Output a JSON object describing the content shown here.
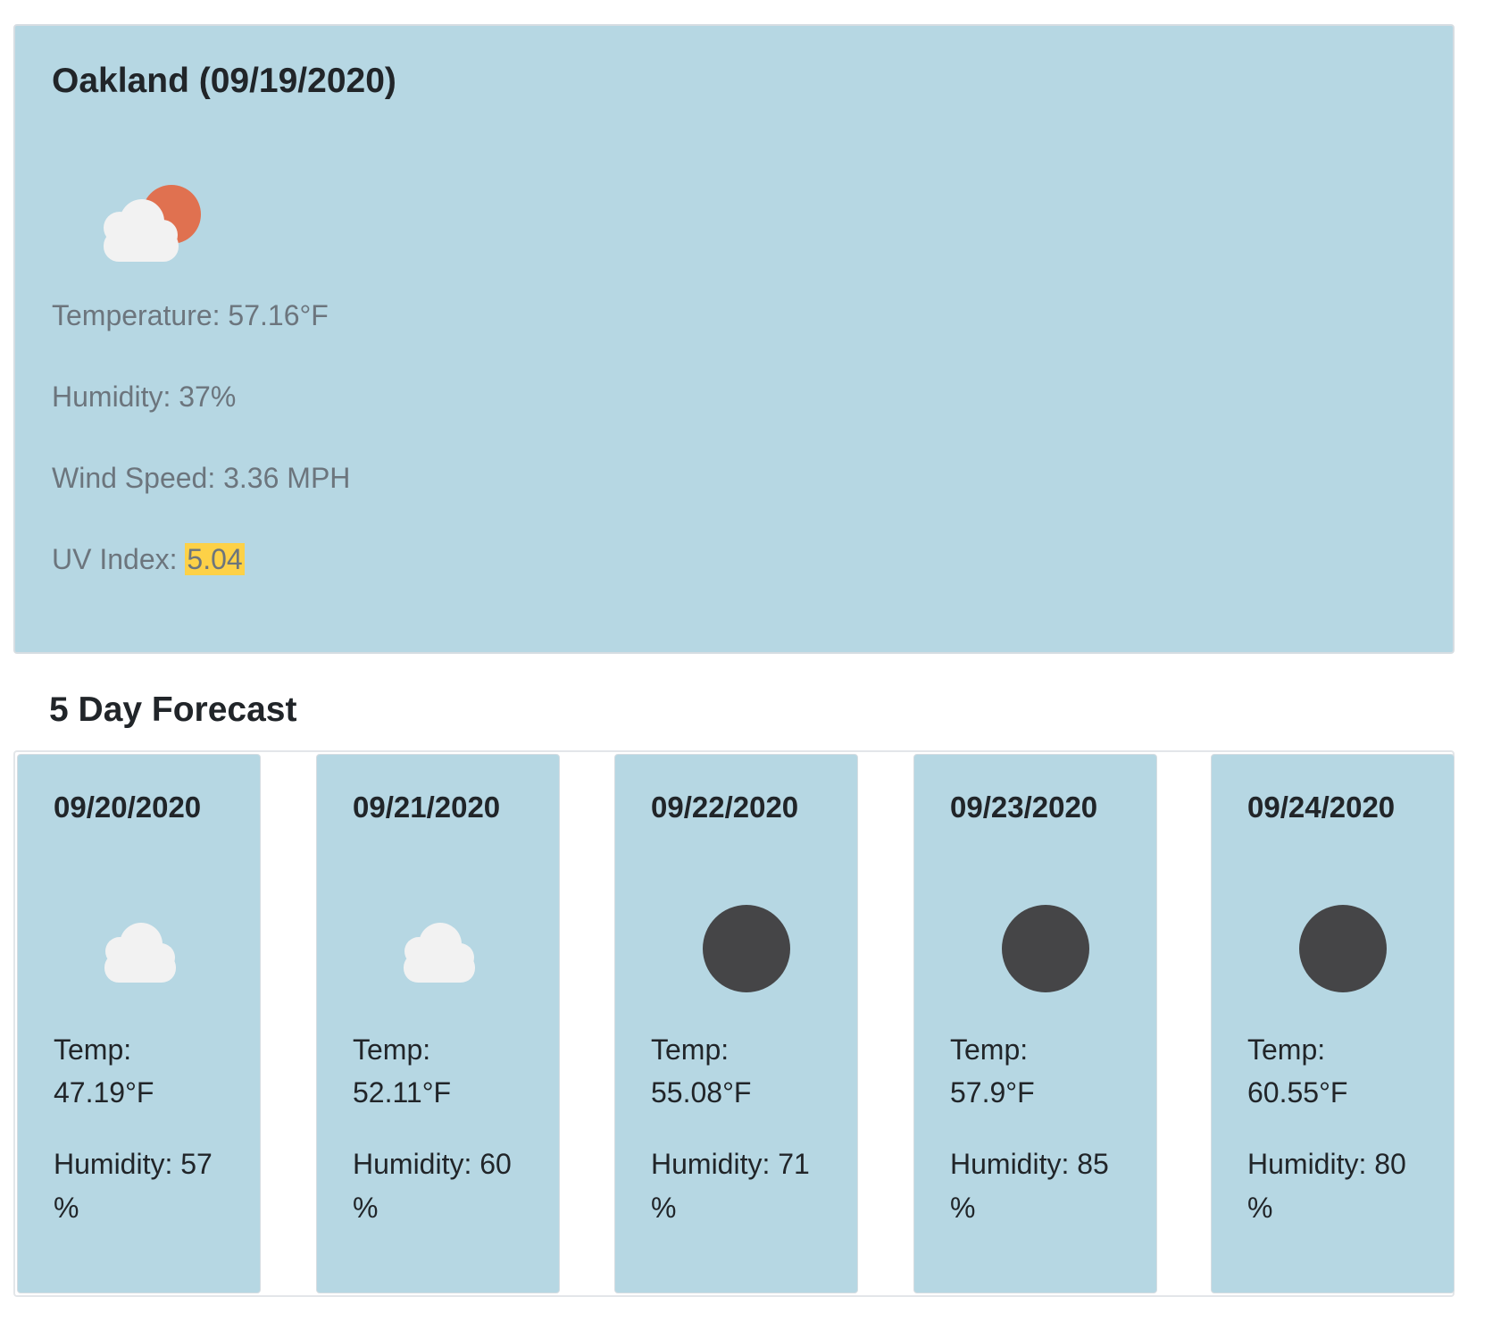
{
  "current": {
    "title": "Oakland (09/19/2020)",
    "icon": "partly-cloudy-day-icon",
    "temperature": "Temperature: 57.16°F",
    "humidity": "Humidity: 37%",
    "wind_speed": "Wind Speed: 3.36 MPH",
    "uv_label": "UV Index: ",
    "uv_value": "5.04",
    "uv_color": "#fdd147"
  },
  "forecast": {
    "heading": "5 Day Forecast",
    "days": [
      {
        "date": "09/20/2020",
        "icon": "cloud-icon",
        "temp_label": "Temp:",
        "temp_value": "47.19°F",
        "humidity_label": "Humidity: 57",
        "humidity_unit": "%"
      },
      {
        "date": "09/21/2020",
        "icon": "cloud-icon",
        "temp_label": "Temp:",
        "temp_value": "52.11°F",
        "humidity_label": "Humidity: 60",
        "humidity_unit": "%"
      },
      {
        "date": "09/22/2020",
        "icon": "moon-icon",
        "temp_label": "Temp:",
        "temp_value": "55.08°F",
        "humidity_label": "Humidity: 71",
        "humidity_unit": "%"
      },
      {
        "date": "09/23/2020",
        "icon": "moon-icon",
        "temp_label": "Temp:",
        "temp_value": "57.9°F",
        "humidity_label": "Humidity: 85",
        "humidity_unit": "%"
      },
      {
        "date": "09/24/2020",
        "icon": "moon-icon",
        "temp_label": "Temp:",
        "temp_value": "60.55°F",
        "humidity_label": "Humidity: 80",
        "humidity_unit": "%"
      }
    ]
  },
  "colors": {
    "card_background": "#b6d7e3",
    "sun": "#e07150",
    "cloud": "#f2f2f2",
    "moon": "#454547"
  }
}
